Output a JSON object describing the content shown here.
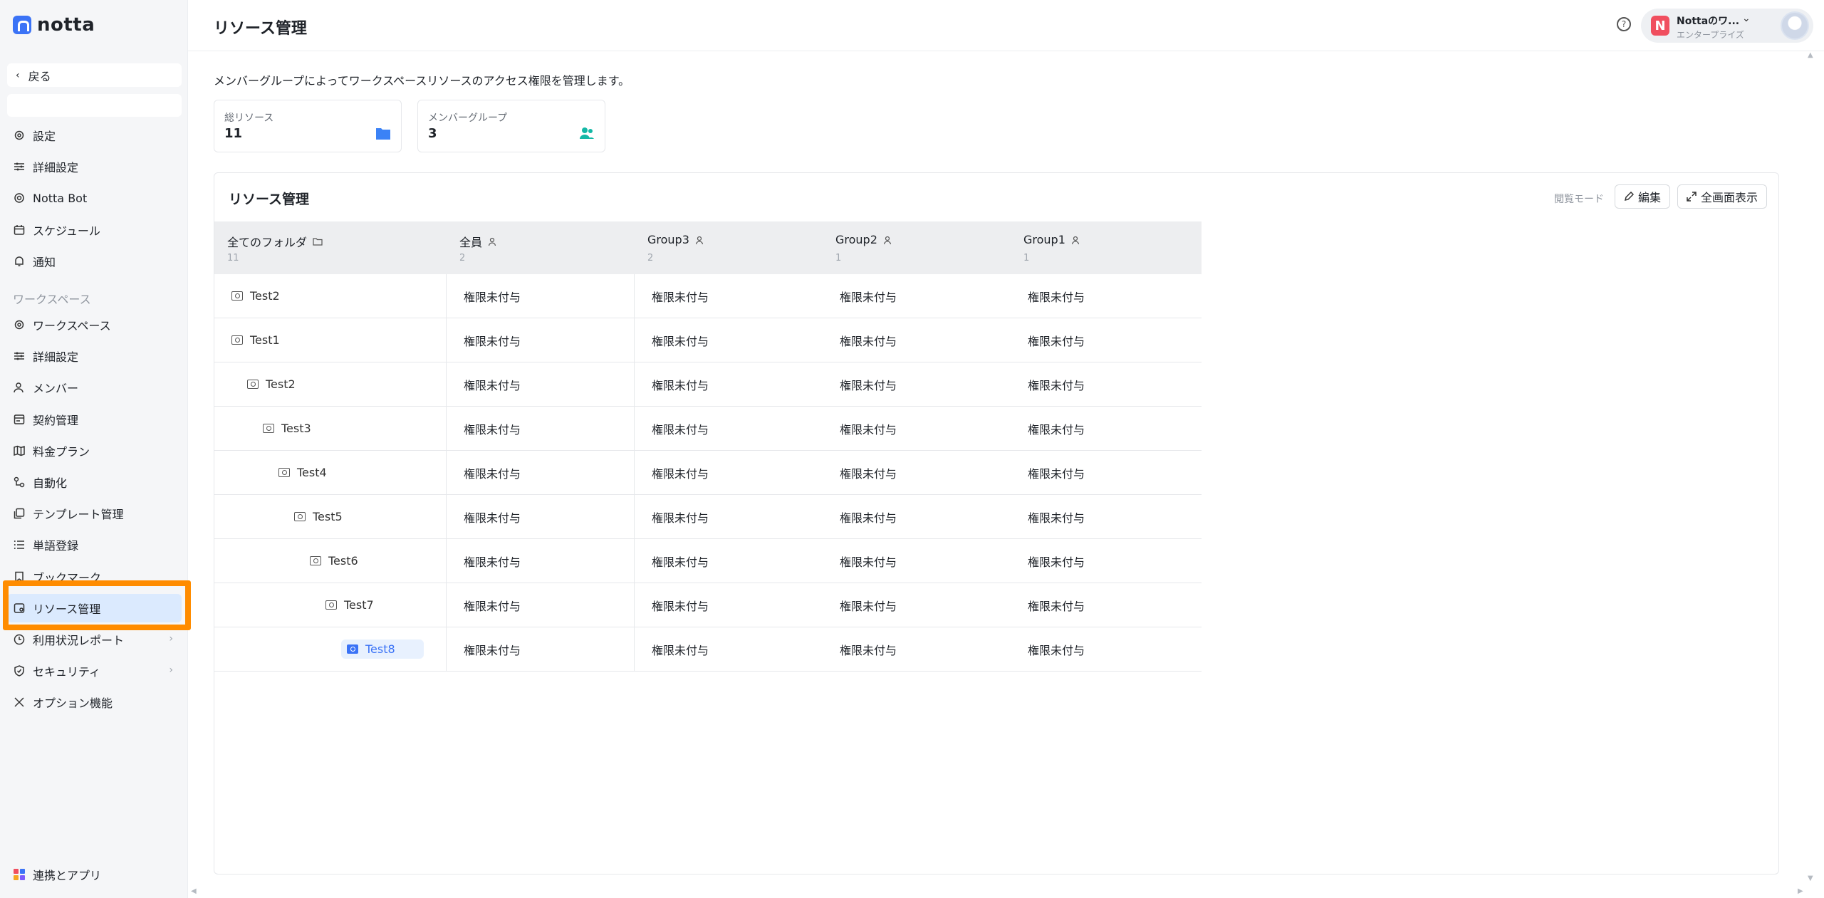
{
  "brand": {
    "name": "notta"
  },
  "sidebar": {
    "back_label": "戻る",
    "items_top": [
      {
        "label": "設定",
        "icon": "gear-icon"
      },
      {
        "label": "詳細設定",
        "icon": "sliders-icon"
      },
      {
        "label": "Notta Bot",
        "icon": "bot-icon"
      },
      {
        "label": "スケジュール",
        "icon": "calendar-icon"
      },
      {
        "label": "通知",
        "icon": "bell-icon"
      }
    ],
    "section_label": "ワークスペース",
    "items_ws": [
      {
        "label": "ワークスペース",
        "icon": "gear-icon"
      },
      {
        "label": "詳細設定",
        "icon": "sliders-icon"
      },
      {
        "label": "メンバー",
        "icon": "user-icon"
      },
      {
        "label": "契約管理",
        "icon": "contract-icon"
      },
      {
        "label": "料金プラン",
        "icon": "map-icon"
      },
      {
        "label": "自動化",
        "icon": "automation-icon"
      },
      {
        "label": "テンプレート管理",
        "icon": "template-icon"
      },
      {
        "label": "単語登録",
        "icon": "list-icon"
      },
      {
        "label": "ブックマーク",
        "icon": "bookmark-icon"
      },
      {
        "label": "リソース管理",
        "icon": "resource-icon",
        "active": true
      },
      {
        "label": "利用状況レポート",
        "icon": "clock-icon",
        "has_submenu": true
      },
      {
        "label": "セキュリティ",
        "icon": "shield-icon",
        "has_submenu": true
      },
      {
        "label": "オプション機能",
        "icon": "tools-icon"
      }
    ],
    "integrations_label": "連携とアプリ"
  },
  "header": {
    "title": "リソース管理",
    "workspace_name": "Nottaのワ...",
    "workspace_initial": "N",
    "workspace_plan": "エンタープライズ"
  },
  "main": {
    "description": "メンバーグループによってワークスペースリソースのアクセス権限を管理します。",
    "stats": [
      {
        "label": "総リソース",
        "value": "11",
        "icon": "folder-icon",
        "color": "#3b82f6"
      },
      {
        "label": "メンバーグループ",
        "value": "3",
        "icon": "group-icon",
        "color": "#14b8a6"
      }
    ],
    "panel": {
      "title": "リソース管理",
      "mode_label": "閲覧モード",
      "edit_label": "編集",
      "fullscreen_label": "全画面表示"
    },
    "table": {
      "columns": [
        {
          "label": "全てのフォルダ",
          "count": "11"
        },
        {
          "label": "全員",
          "count": "2"
        },
        {
          "label": "Group3",
          "count": "2"
        },
        {
          "label": "Group2",
          "count": "1"
        },
        {
          "label": "Group1",
          "count": "1"
        }
      ],
      "rows": [
        {
          "folder": "Test2",
          "depth": 0,
          "perms": [
            "権限未付与",
            "権限未付与",
            "権限未付与",
            "権限未付与"
          ]
        },
        {
          "folder": "Test1",
          "depth": 0,
          "perms": [
            "権限未付与",
            "権限未付与",
            "権限未付与",
            "権限未付与"
          ]
        },
        {
          "folder": "Test2",
          "depth": 1,
          "perms": [
            "権限未付与",
            "権限未付与",
            "権限未付与",
            "権限未付与"
          ]
        },
        {
          "folder": "Test3",
          "depth": 2,
          "perms": [
            "権限未付与",
            "権限未付与",
            "権限未付与",
            "権限未付与"
          ]
        },
        {
          "folder": "Test4",
          "depth": 3,
          "perms": [
            "権限未付与",
            "権限未付与",
            "権限未付与",
            "権限未付与"
          ]
        },
        {
          "folder": "Test5",
          "depth": 4,
          "perms": [
            "権限未付与",
            "権限未付与",
            "権限未付与",
            "権限未付与"
          ]
        },
        {
          "folder": "Test6",
          "depth": 5,
          "perms": [
            "権限未付与",
            "権限未付与",
            "権限未付与",
            "権限未付与"
          ]
        },
        {
          "folder": "Test7",
          "depth": 6,
          "perms": [
            "権限未付与",
            "権限未付与",
            "権限未付与",
            "権限未付与"
          ]
        },
        {
          "folder": "Test8",
          "depth": 7,
          "selected": true,
          "perms": [
            "権限未付与",
            "権限未付与",
            "権限未付与",
            "権限未付与"
          ]
        }
      ]
    }
  }
}
